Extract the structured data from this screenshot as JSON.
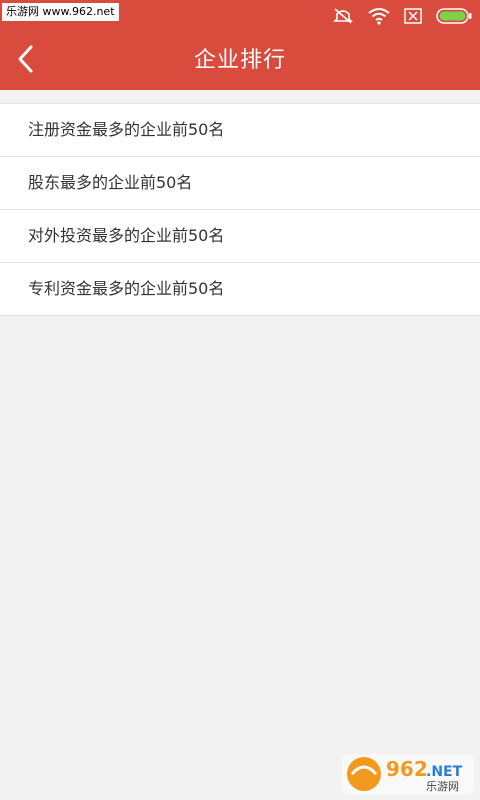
{
  "status_bar": {
    "watermark": "乐游网 www.962.net",
    "icons": [
      "mute-icon",
      "wifi-icon",
      "sim-off-icon",
      "battery-icon"
    ],
    "color": "#d94b3c"
  },
  "header": {
    "title": "企业排行",
    "back_icon": "chevron-left-icon",
    "color": "#d94b3c"
  },
  "list": {
    "items": [
      {
        "label": "注册资金最多的企业前50名"
      },
      {
        "label": "股东最多的企业前50名"
      },
      {
        "label": "对外投资最多的企业前50名"
      },
      {
        "label": "专利资金最多的企业前50名"
      }
    ]
  },
  "logo_watermark": {
    "number": "962",
    "suffix": ".NET",
    "text": "乐游网"
  }
}
